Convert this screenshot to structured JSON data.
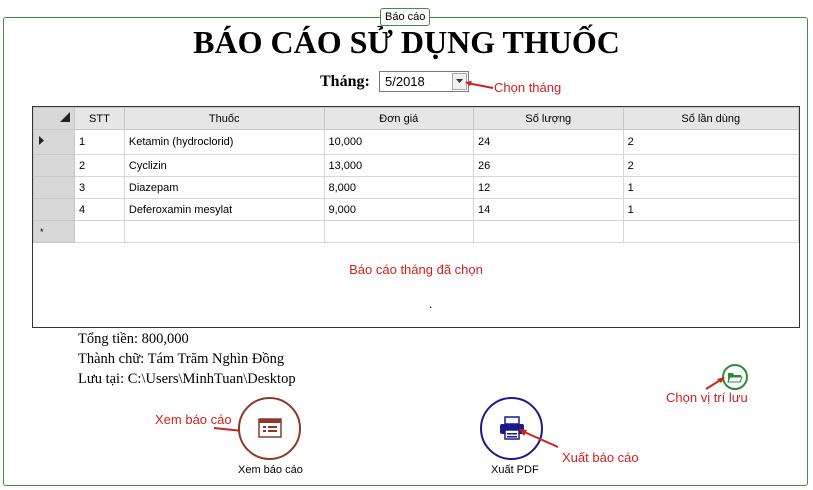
{
  "group": {
    "caption": "Báo cáo"
  },
  "title": "BÁO CÁO SỬ DỤNG THUỐC",
  "month": {
    "label": "Tháng:",
    "value": "5/2018"
  },
  "annotations": {
    "choose_month": "Chọn tháng",
    "report_selected_month": "Báo cáo tháng đã chọn",
    "view_report": "Xem báo cáo",
    "export_report": "Xuất báo cáo",
    "choose_location": "Chọn vị trí lưu"
  },
  "grid": {
    "columns": [
      "STT",
      "Thuốc",
      "Đơn giá",
      "Số lượng",
      "Số lần dùng"
    ],
    "rows": [
      [
        "1",
        "Ketamin (hydroclorid)",
        "10,000",
        "24",
        "2"
      ],
      [
        "2",
        "Cyclizin",
        "13,000",
        "26",
        "2"
      ],
      [
        "3",
        "Diazepam",
        "8,000",
        "12",
        "1"
      ],
      [
        "4",
        "Deferoxamin mesylat",
        "9,000",
        "14",
        "1"
      ]
    ],
    "new_row_marker": "*",
    "dot": "."
  },
  "summary": {
    "total": "Tổng tiền: 800,000",
    "in_words": "Thành chữ: Tám Trăm Nghìn Đồng",
    "saved_at": "Lưu tại:  C:\\Users\\MinhTuan\\Desktop"
  },
  "buttons": {
    "view_report": "Xem báo cáo",
    "export_pdf": "Xuất PDF"
  },
  "colors": {
    "annotation": "#d02020",
    "frame": "#3f8f3f",
    "view_ring": "#8b3a2a",
    "pdf_ring": "#1a1a8c",
    "folder": "#2e8b3a"
  },
  "icons": [
    "dropdown-arrow-icon",
    "row-pointer-icon",
    "report-icon",
    "printer-icon",
    "folder-icon"
  ]
}
